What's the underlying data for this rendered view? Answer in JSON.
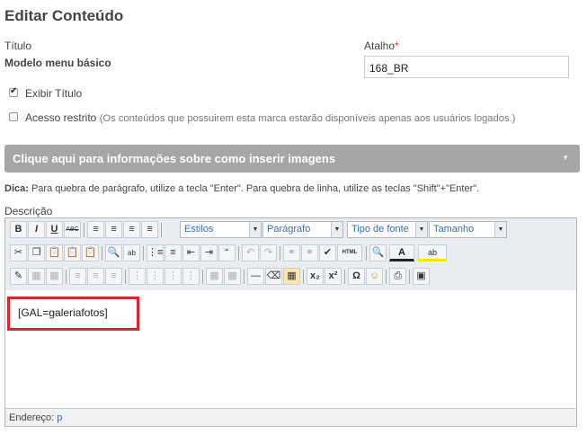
{
  "page": {
    "title": "Editar Conteúdo"
  },
  "fields": {
    "titulo_label": "Título",
    "titulo_value": "Modelo menu básico",
    "atalho_label": "Atalho",
    "atalho_required": "*",
    "atalho_value": "168_BR"
  },
  "checkboxes": {
    "exibir_titulo": {
      "label": "Exibir Título",
      "checked": true
    },
    "acesso_restrito": {
      "label": "Acesso restrito",
      "checked": false,
      "hint": "(Os conteúdos que possuirem esta marca estarão disponíveis apenas aos usuários logados.)"
    }
  },
  "banner": {
    "text": "Clique aqui para informações sobre como inserir imagens"
  },
  "tip": {
    "label": "Dica:",
    "text": " Para quebra de parágrafo, utilize a tecla \"Enter\". Para quebra de linha, utilize as teclas \"Shift\"+\"Enter\"."
  },
  "editor": {
    "label": "Descrição",
    "toolbar": {
      "bold": "B",
      "italic": "I",
      "underline": "U",
      "strike": "ABC",
      "styles": "Estilos",
      "format": "Parágrafo",
      "font": "Tipo de fonte",
      "size": "Tamanho",
      "html": "HTML",
      "omega": "Ω",
      "subscript": "x₂",
      "superscript": "x²"
    },
    "content": "[GAL=galeriafotos]",
    "path_label": "Endereço:",
    "path_value": "p"
  }
}
